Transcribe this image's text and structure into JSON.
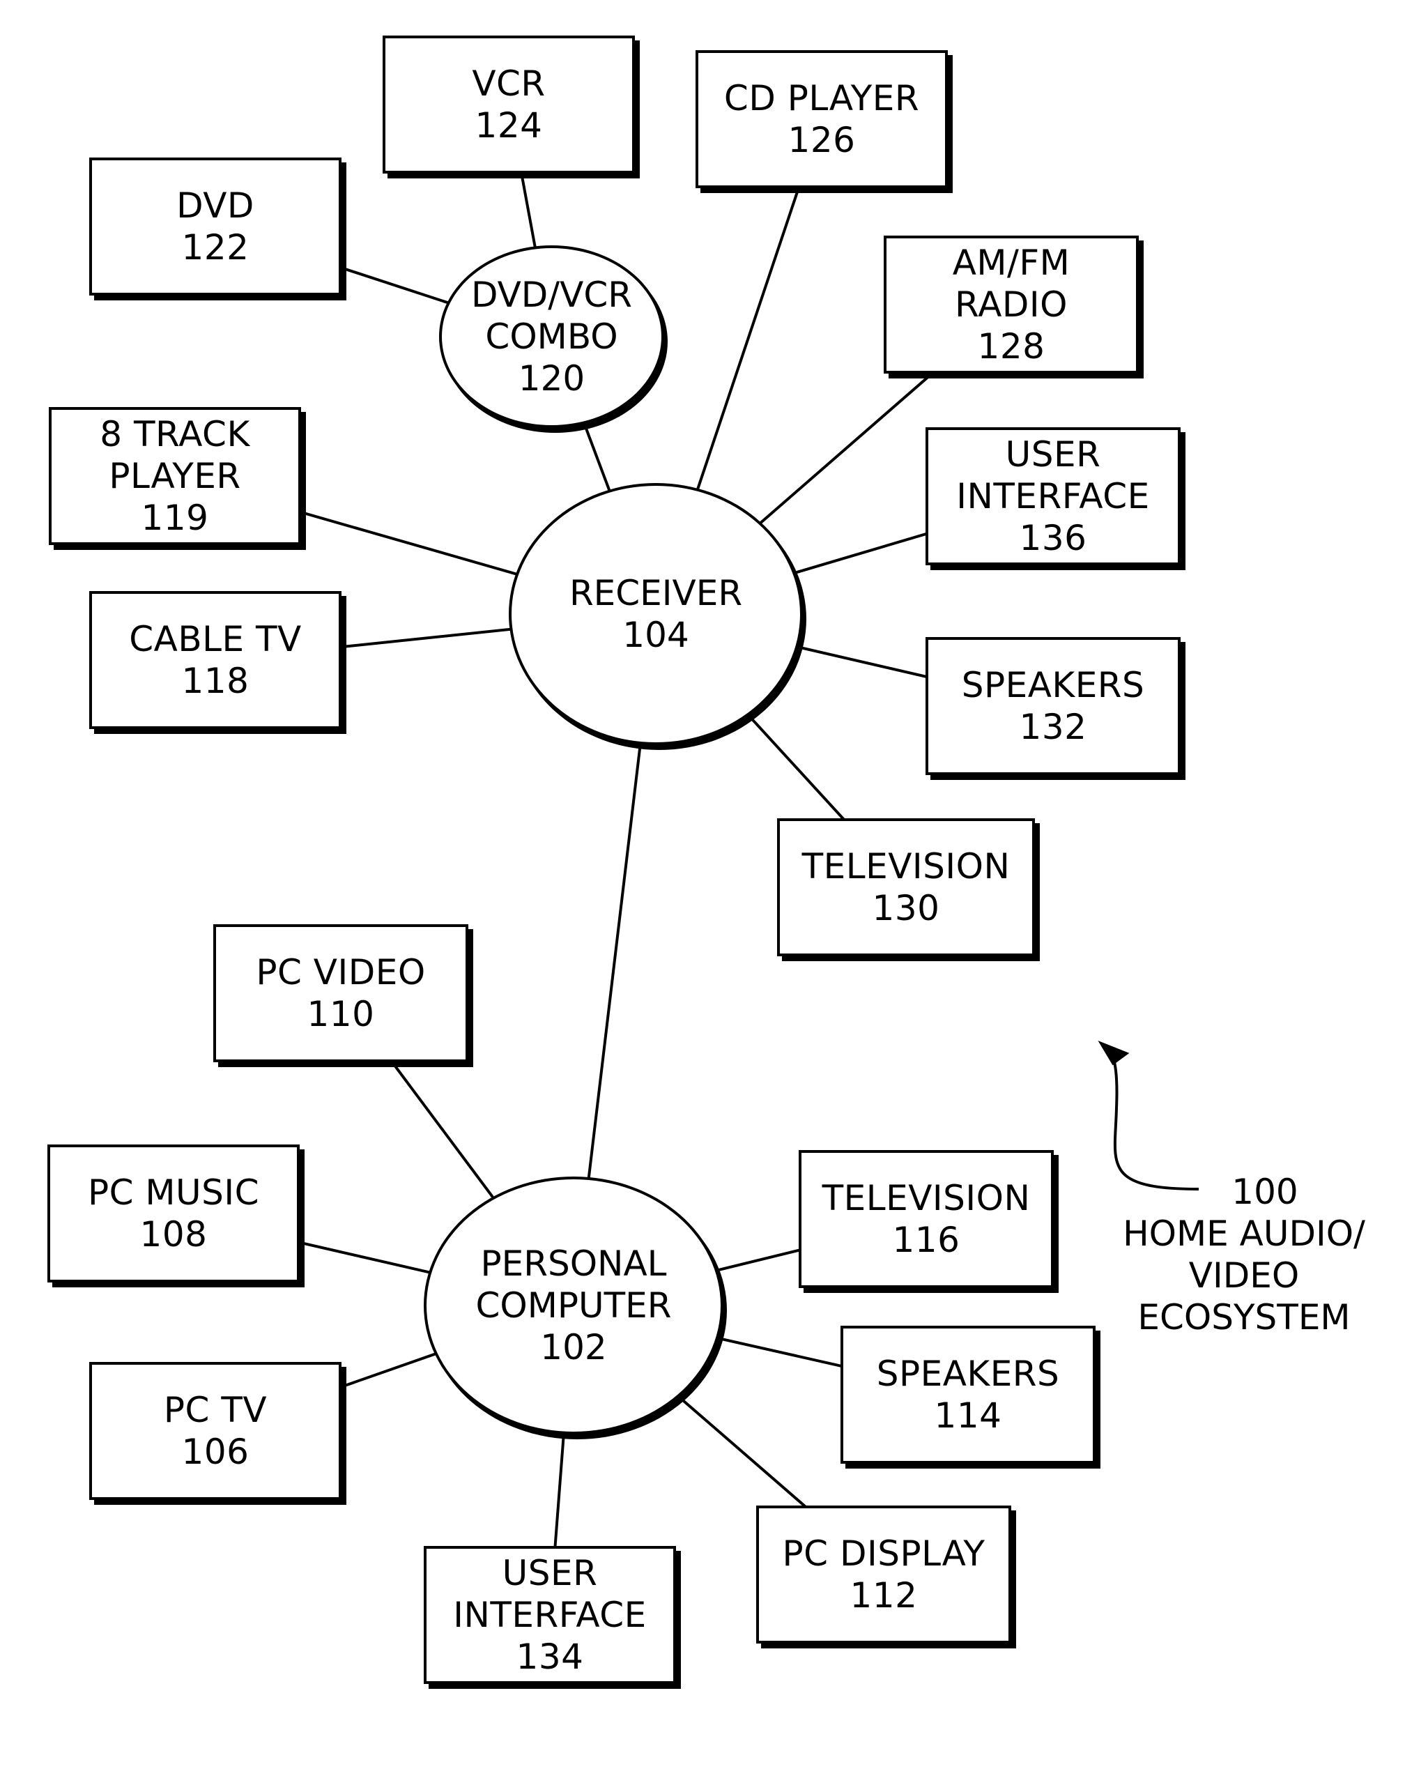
{
  "figure": {
    "reference_number": "100",
    "caption_lines": [
      "HOME AUDIO/",
      "VIDEO",
      "ECOSYSTEM"
    ]
  },
  "hubs": {
    "receiver": {
      "lines": [
        "RECEIVER",
        "104"
      ]
    },
    "personal_computer": {
      "lines": [
        "PERSONAL",
        "COMPUTER",
        "102"
      ]
    },
    "dvd_vcr_combo": {
      "lines": [
        "DVD/VCR",
        "COMBO",
        "120"
      ]
    }
  },
  "devices": {
    "vcr": {
      "lines": [
        "VCR",
        "124"
      ]
    },
    "dvd": {
      "lines": [
        "DVD",
        "122"
      ]
    },
    "cd_player": {
      "lines": [
        "CD PLAYER",
        "126"
      ]
    },
    "am_fm_radio": {
      "lines": [
        "AM/FM",
        "RADIO",
        "128"
      ]
    },
    "eight_track": {
      "lines": [
        "8 TRACK",
        "PLAYER",
        "119"
      ]
    },
    "cable_tv": {
      "lines": [
        "CABLE TV",
        "118"
      ]
    },
    "user_interface_136": {
      "lines": [
        "USER",
        "INTERFACE",
        "136"
      ]
    },
    "speakers_132": {
      "lines": [
        "SPEAKERS",
        "132"
      ]
    },
    "television_130": {
      "lines": [
        "TELEVISION",
        "130"
      ]
    },
    "pc_video": {
      "lines": [
        "PC VIDEO",
        "110"
      ]
    },
    "pc_music": {
      "lines": [
        "PC MUSIC",
        "108"
      ]
    },
    "pc_tv": {
      "lines": [
        "PC TV",
        "106"
      ]
    },
    "user_interface_134": {
      "lines": [
        "USER",
        "INTERFACE",
        "134"
      ]
    },
    "pc_display": {
      "lines": [
        "PC DISPLAY",
        "112"
      ]
    },
    "speakers_114": {
      "lines": [
        "SPEAKERS",
        "114"
      ]
    },
    "television_116": {
      "lines": [
        "TELEVISION",
        "116"
      ]
    }
  },
  "connections": [
    {
      "from": "vcr",
      "to": "dvd_vcr_combo"
    },
    {
      "from": "dvd",
      "to": "dvd_vcr_combo"
    },
    {
      "from": "dvd_vcr_combo",
      "to": "receiver"
    },
    {
      "from": "cd_player",
      "to": "receiver"
    },
    {
      "from": "am_fm_radio",
      "to": "receiver"
    },
    {
      "from": "eight_track",
      "to": "receiver"
    },
    {
      "from": "cable_tv",
      "to": "receiver"
    },
    {
      "from": "user_interface_136",
      "to": "receiver"
    },
    {
      "from": "speakers_132",
      "to": "receiver"
    },
    {
      "from": "television_130",
      "to": "receiver"
    },
    {
      "from": "receiver",
      "to": "personal_computer"
    },
    {
      "from": "pc_video",
      "to": "personal_computer"
    },
    {
      "from": "pc_music",
      "to": "personal_computer"
    },
    {
      "from": "pc_tv",
      "to": "personal_computer"
    },
    {
      "from": "user_interface_134",
      "to": "personal_computer"
    },
    {
      "from": "pc_display",
      "to": "personal_computer"
    },
    {
      "from": "speakers_114",
      "to": "personal_computer"
    },
    {
      "from": "television_116",
      "to": "personal_computer"
    }
  ]
}
